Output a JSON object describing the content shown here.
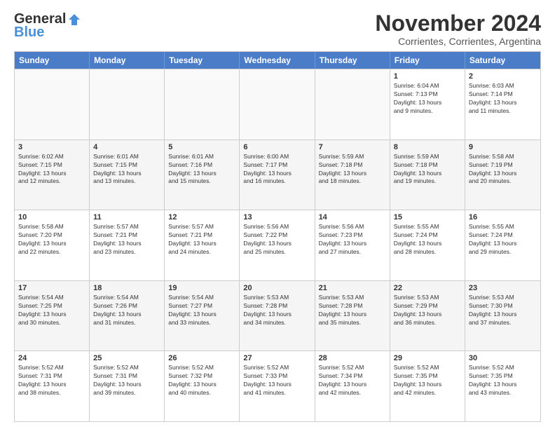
{
  "logo": {
    "general": "General",
    "blue": "Blue"
  },
  "header": {
    "month": "November 2024",
    "location": "Corrientes, Corrientes, Argentina"
  },
  "weekdays": [
    "Sunday",
    "Monday",
    "Tuesday",
    "Wednesday",
    "Thursday",
    "Friday",
    "Saturday"
  ],
  "rows": [
    [
      {
        "day": "",
        "empty": true
      },
      {
        "day": "",
        "empty": true
      },
      {
        "day": "",
        "empty": true
      },
      {
        "day": "",
        "empty": true
      },
      {
        "day": "",
        "empty": true
      },
      {
        "day": "1",
        "info": "Sunrise: 6:04 AM\nSunset: 7:13 PM\nDaylight: 13 hours\nand 9 minutes."
      },
      {
        "day": "2",
        "info": "Sunrise: 6:03 AM\nSunset: 7:14 PM\nDaylight: 13 hours\nand 11 minutes."
      }
    ],
    [
      {
        "day": "3",
        "info": "Sunrise: 6:02 AM\nSunset: 7:15 PM\nDaylight: 13 hours\nand 12 minutes."
      },
      {
        "day": "4",
        "info": "Sunrise: 6:01 AM\nSunset: 7:15 PM\nDaylight: 13 hours\nand 13 minutes."
      },
      {
        "day": "5",
        "info": "Sunrise: 6:01 AM\nSunset: 7:16 PM\nDaylight: 13 hours\nand 15 minutes."
      },
      {
        "day": "6",
        "info": "Sunrise: 6:00 AM\nSunset: 7:17 PM\nDaylight: 13 hours\nand 16 minutes."
      },
      {
        "day": "7",
        "info": "Sunrise: 5:59 AM\nSunset: 7:18 PM\nDaylight: 13 hours\nand 18 minutes."
      },
      {
        "day": "8",
        "info": "Sunrise: 5:59 AM\nSunset: 7:18 PM\nDaylight: 13 hours\nand 19 minutes."
      },
      {
        "day": "9",
        "info": "Sunrise: 5:58 AM\nSunset: 7:19 PM\nDaylight: 13 hours\nand 20 minutes."
      }
    ],
    [
      {
        "day": "10",
        "info": "Sunrise: 5:58 AM\nSunset: 7:20 PM\nDaylight: 13 hours\nand 22 minutes."
      },
      {
        "day": "11",
        "info": "Sunrise: 5:57 AM\nSunset: 7:21 PM\nDaylight: 13 hours\nand 23 minutes."
      },
      {
        "day": "12",
        "info": "Sunrise: 5:57 AM\nSunset: 7:21 PM\nDaylight: 13 hours\nand 24 minutes."
      },
      {
        "day": "13",
        "info": "Sunrise: 5:56 AM\nSunset: 7:22 PM\nDaylight: 13 hours\nand 25 minutes."
      },
      {
        "day": "14",
        "info": "Sunrise: 5:56 AM\nSunset: 7:23 PM\nDaylight: 13 hours\nand 27 minutes."
      },
      {
        "day": "15",
        "info": "Sunrise: 5:55 AM\nSunset: 7:24 PM\nDaylight: 13 hours\nand 28 minutes."
      },
      {
        "day": "16",
        "info": "Sunrise: 5:55 AM\nSunset: 7:24 PM\nDaylight: 13 hours\nand 29 minutes."
      }
    ],
    [
      {
        "day": "17",
        "info": "Sunrise: 5:54 AM\nSunset: 7:25 PM\nDaylight: 13 hours\nand 30 minutes."
      },
      {
        "day": "18",
        "info": "Sunrise: 5:54 AM\nSunset: 7:26 PM\nDaylight: 13 hours\nand 31 minutes."
      },
      {
        "day": "19",
        "info": "Sunrise: 5:54 AM\nSunset: 7:27 PM\nDaylight: 13 hours\nand 33 minutes."
      },
      {
        "day": "20",
        "info": "Sunrise: 5:53 AM\nSunset: 7:28 PM\nDaylight: 13 hours\nand 34 minutes."
      },
      {
        "day": "21",
        "info": "Sunrise: 5:53 AM\nSunset: 7:28 PM\nDaylight: 13 hours\nand 35 minutes."
      },
      {
        "day": "22",
        "info": "Sunrise: 5:53 AM\nSunset: 7:29 PM\nDaylight: 13 hours\nand 36 minutes."
      },
      {
        "day": "23",
        "info": "Sunrise: 5:53 AM\nSunset: 7:30 PM\nDaylight: 13 hours\nand 37 minutes."
      }
    ],
    [
      {
        "day": "24",
        "info": "Sunrise: 5:52 AM\nSunset: 7:31 PM\nDaylight: 13 hours\nand 38 minutes."
      },
      {
        "day": "25",
        "info": "Sunrise: 5:52 AM\nSunset: 7:31 PM\nDaylight: 13 hours\nand 39 minutes."
      },
      {
        "day": "26",
        "info": "Sunrise: 5:52 AM\nSunset: 7:32 PM\nDaylight: 13 hours\nand 40 minutes."
      },
      {
        "day": "27",
        "info": "Sunrise: 5:52 AM\nSunset: 7:33 PM\nDaylight: 13 hours\nand 41 minutes."
      },
      {
        "day": "28",
        "info": "Sunrise: 5:52 AM\nSunset: 7:34 PM\nDaylight: 13 hours\nand 42 minutes."
      },
      {
        "day": "29",
        "info": "Sunrise: 5:52 AM\nSunset: 7:35 PM\nDaylight: 13 hours\nand 42 minutes."
      },
      {
        "day": "30",
        "info": "Sunrise: 5:52 AM\nSunset: 7:35 PM\nDaylight: 13 hours\nand 43 minutes."
      }
    ]
  ]
}
